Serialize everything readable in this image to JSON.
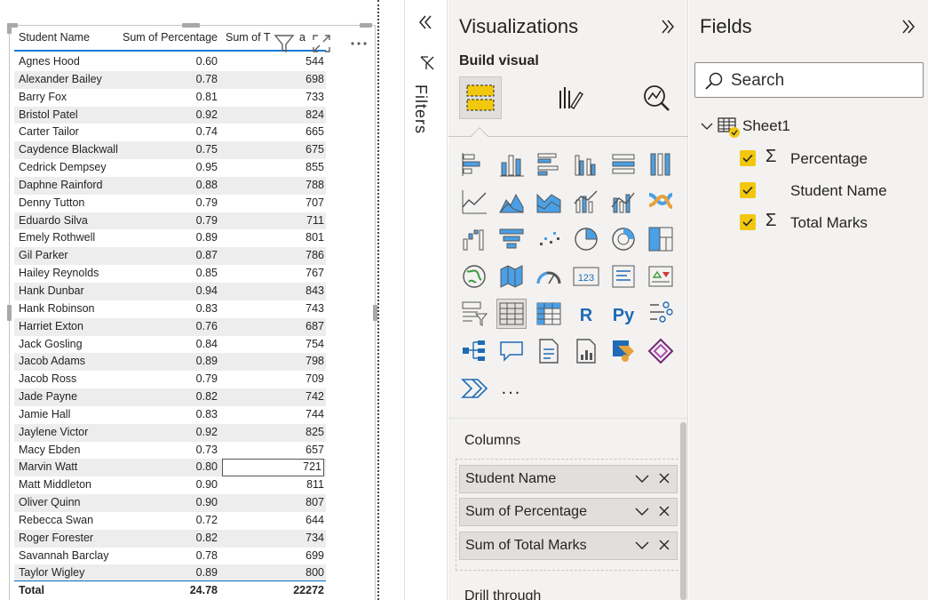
{
  "table": {
    "headers": [
      "Student Name",
      "Sum of Percentage",
      "Sum of T",
      "a"
    ],
    "rows": [
      {
        "name": "Agnes Hood",
        "pct": "0.60",
        "marks": "544"
      },
      {
        "name": "Alexander Bailey",
        "pct": "0.78",
        "marks": "698"
      },
      {
        "name": "Barry Fox",
        "pct": "0.81",
        "marks": "733"
      },
      {
        "name": "Bristol Patel",
        "pct": "0.92",
        "marks": "824"
      },
      {
        "name": "Carter Tailor",
        "pct": "0.74",
        "marks": "665"
      },
      {
        "name": "Caydence Blackwall",
        "pct": "0.75",
        "marks": "675"
      },
      {
        "name": "Cedrick Dempsey",
        "pct": "0.95",
        "marks": "855"
      },
      {
        "name": "Daphne Rainford",
        "pct": "0.88",
        "marks": "788"
      },
      {
        "name": "Denny Tutton",
        "pct": "0.79",
        "marks": "707"
      },
      {
        "name": "Eduardo Silva",
        "pct": "0.79",
        "marks": "711"
      },
      {
        "name": "Emely Rothwell",
        "pct": "0.89",
        "marks": "801"
      },
      {
        "name": "Gil Parker",
        "pct": "0.87",
        "marks": "786"
      },
      {
        "name": "Hailey Reynolds",
        "pct": "0.85",
        "marks": "767"
      },
      {
        "name": "Hank Dunbar",
        "pct": "0.94",
        "marks": "843"
      },
      {
        "name": "Hank Robinson",
        "pct": "0.83",
        "marks": "743"
      },
      {
        "name": "Harriet Exton",
        "pct": "0.76",
        "marks": "687"
      },
      {
        "name": "Jack Gosling",
        "pct": "0.84",
        "marks": "754"
      },
      {
        "name": "Jacob Adams",
        "pct": "0.89",
        "marks": "798"
      },
      {
        "name": "Jacob Ross",
        "pct": "0.79",
        "marks": "709"
      },
      {
        "name": "Jade Payne",
        "pct": "0.82",
        "marks": "742"
      },
      {
        "name": "Jamie Hall",
        "pct": "0.83",
        "marks": "744"
      },
      {
        "name": "Jaylene Victor",
        "pct": "0.92",
        "marks": "825"
      },
      {
        "name": "Macy Ebden",
        "pct": "0.73",
        "marks": "657"
      },
      {
        "name": "Marvin Watt",
        "pct": "0.80",
        "marks": "721",
        "selected": true
      },
      {
        "name": "Matt Middleton",
        "pct": "0.90",
        "marks": "811"
      },
      {
        "name": "Oliver Quinn",
        "pct": "0.90",
        "marks": "807"
      },
      {
        "name": "Rebecca Swan",
        "pct": "0.72",
        "marks": "644"
      },
      {
        "name": "Roger Forester",
        "pct": "0.82",
        "marks": "734"
      },
      {
        "name": "Savannah Barclay",
        "pct": "0.78",
        "marks": "699"
      },
      {
        "name": "Taylor Wigley",
        "pct": "0.89",
        "marks": "800"
      }
    ],
    "total": {
      "label": "Total",
      "pct": "24.78",
      "marks": "22272"
    },
    "visual_tools": [
      "filter-icon",
      "focus-mode-icon",
      "more-options-icon"
    ]
  },
  "filters": {
    "label": "Filters"
  },
  "visualizations": {
    "title": "Visualizations",
    "build_visual": "Build visual",
    "columns_label": "Columns",
    "wells": [
      "Student Name",
      "Sum of Percentage",
      "Sum of Total Marks"
    ],
    "drill_through": "Drill through",
    "more_visuals": "..."
  },
  "fields": {
    "title": "Fields",
    "search_placeholder": "Search",
    "table_name": "Sheet1",
    "items": [
      {
        "label": "Percentage",
        "sigma": true
      },
      {
        "label": "Student Name",
        "sigma": false
      },
      {
        "label": "Total Marks",
        "sigma": true
      }
    ]
  },
  "colors": {
    "accent_blue": "#1f6bb5",
    "check_yellow": "#f2c80f",
    "header_underline": "#0e7bd3"
  }
}
